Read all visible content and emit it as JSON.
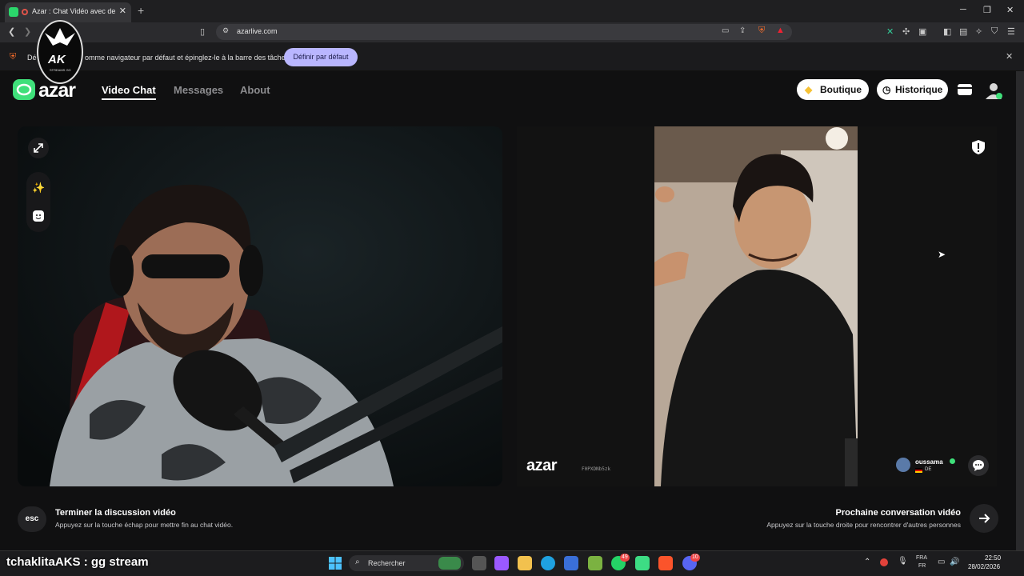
{
  "browser": {
    "tab_title": "Azar : Chat Vidéo avec de no",
    "url": "azarlive.com",
    "infobar_text_start": "Dé",
    "infobar_text": "omme navigateur par défaut et épinglez-le à la barre des tâches",
    "set_default_label": "Définir par défaut"
  },
  "site": {
    "logo": "azar",
    "nav": [
      "Video Chat",
      "Messages",
      "About"
    ],
    "boutique_label": "Boutique",
    "historique_label": "Historique"
  },
  "call": {
    "watermark": "azar",
    "watermark_id": "F0PXDNb5zk",
    "peer_name": "oussama",
    "peer_country": "DE"
  },
  "footer": {
    "esc_key": "esc",
    "end_title": "Terminer la discussion vidéo",
    "end_sub": "Appuyez sur la touche échap pour mettre fin au chat vidéo.",
    "next_title": "Prochaine conversation vidéo",
    "next_sub": "Appuyez sur la touche droite pour rencontrer d'autres personnes"
  },
  "taskbar": {
    "overlay_chat": "tchaklitaAKS : gg stream",
    "search_label": "Rechercher",
    "lang1": "FRA",
    "lang2": "FR",
    "time": "22:50",
    "date": "28/02/2026",
    "whatsapp_badge": "49",
    "discord_badge": "10"
  },
  "stream_badge": {
    "title": "AK",
    "subtitle": "STREAMS GG"
  },
  "colors": {
    "accent_green": "#3fe07a",
    "set_default_bg": "#b9b6ff",
    "page_bg": "#101011"
  }
}
